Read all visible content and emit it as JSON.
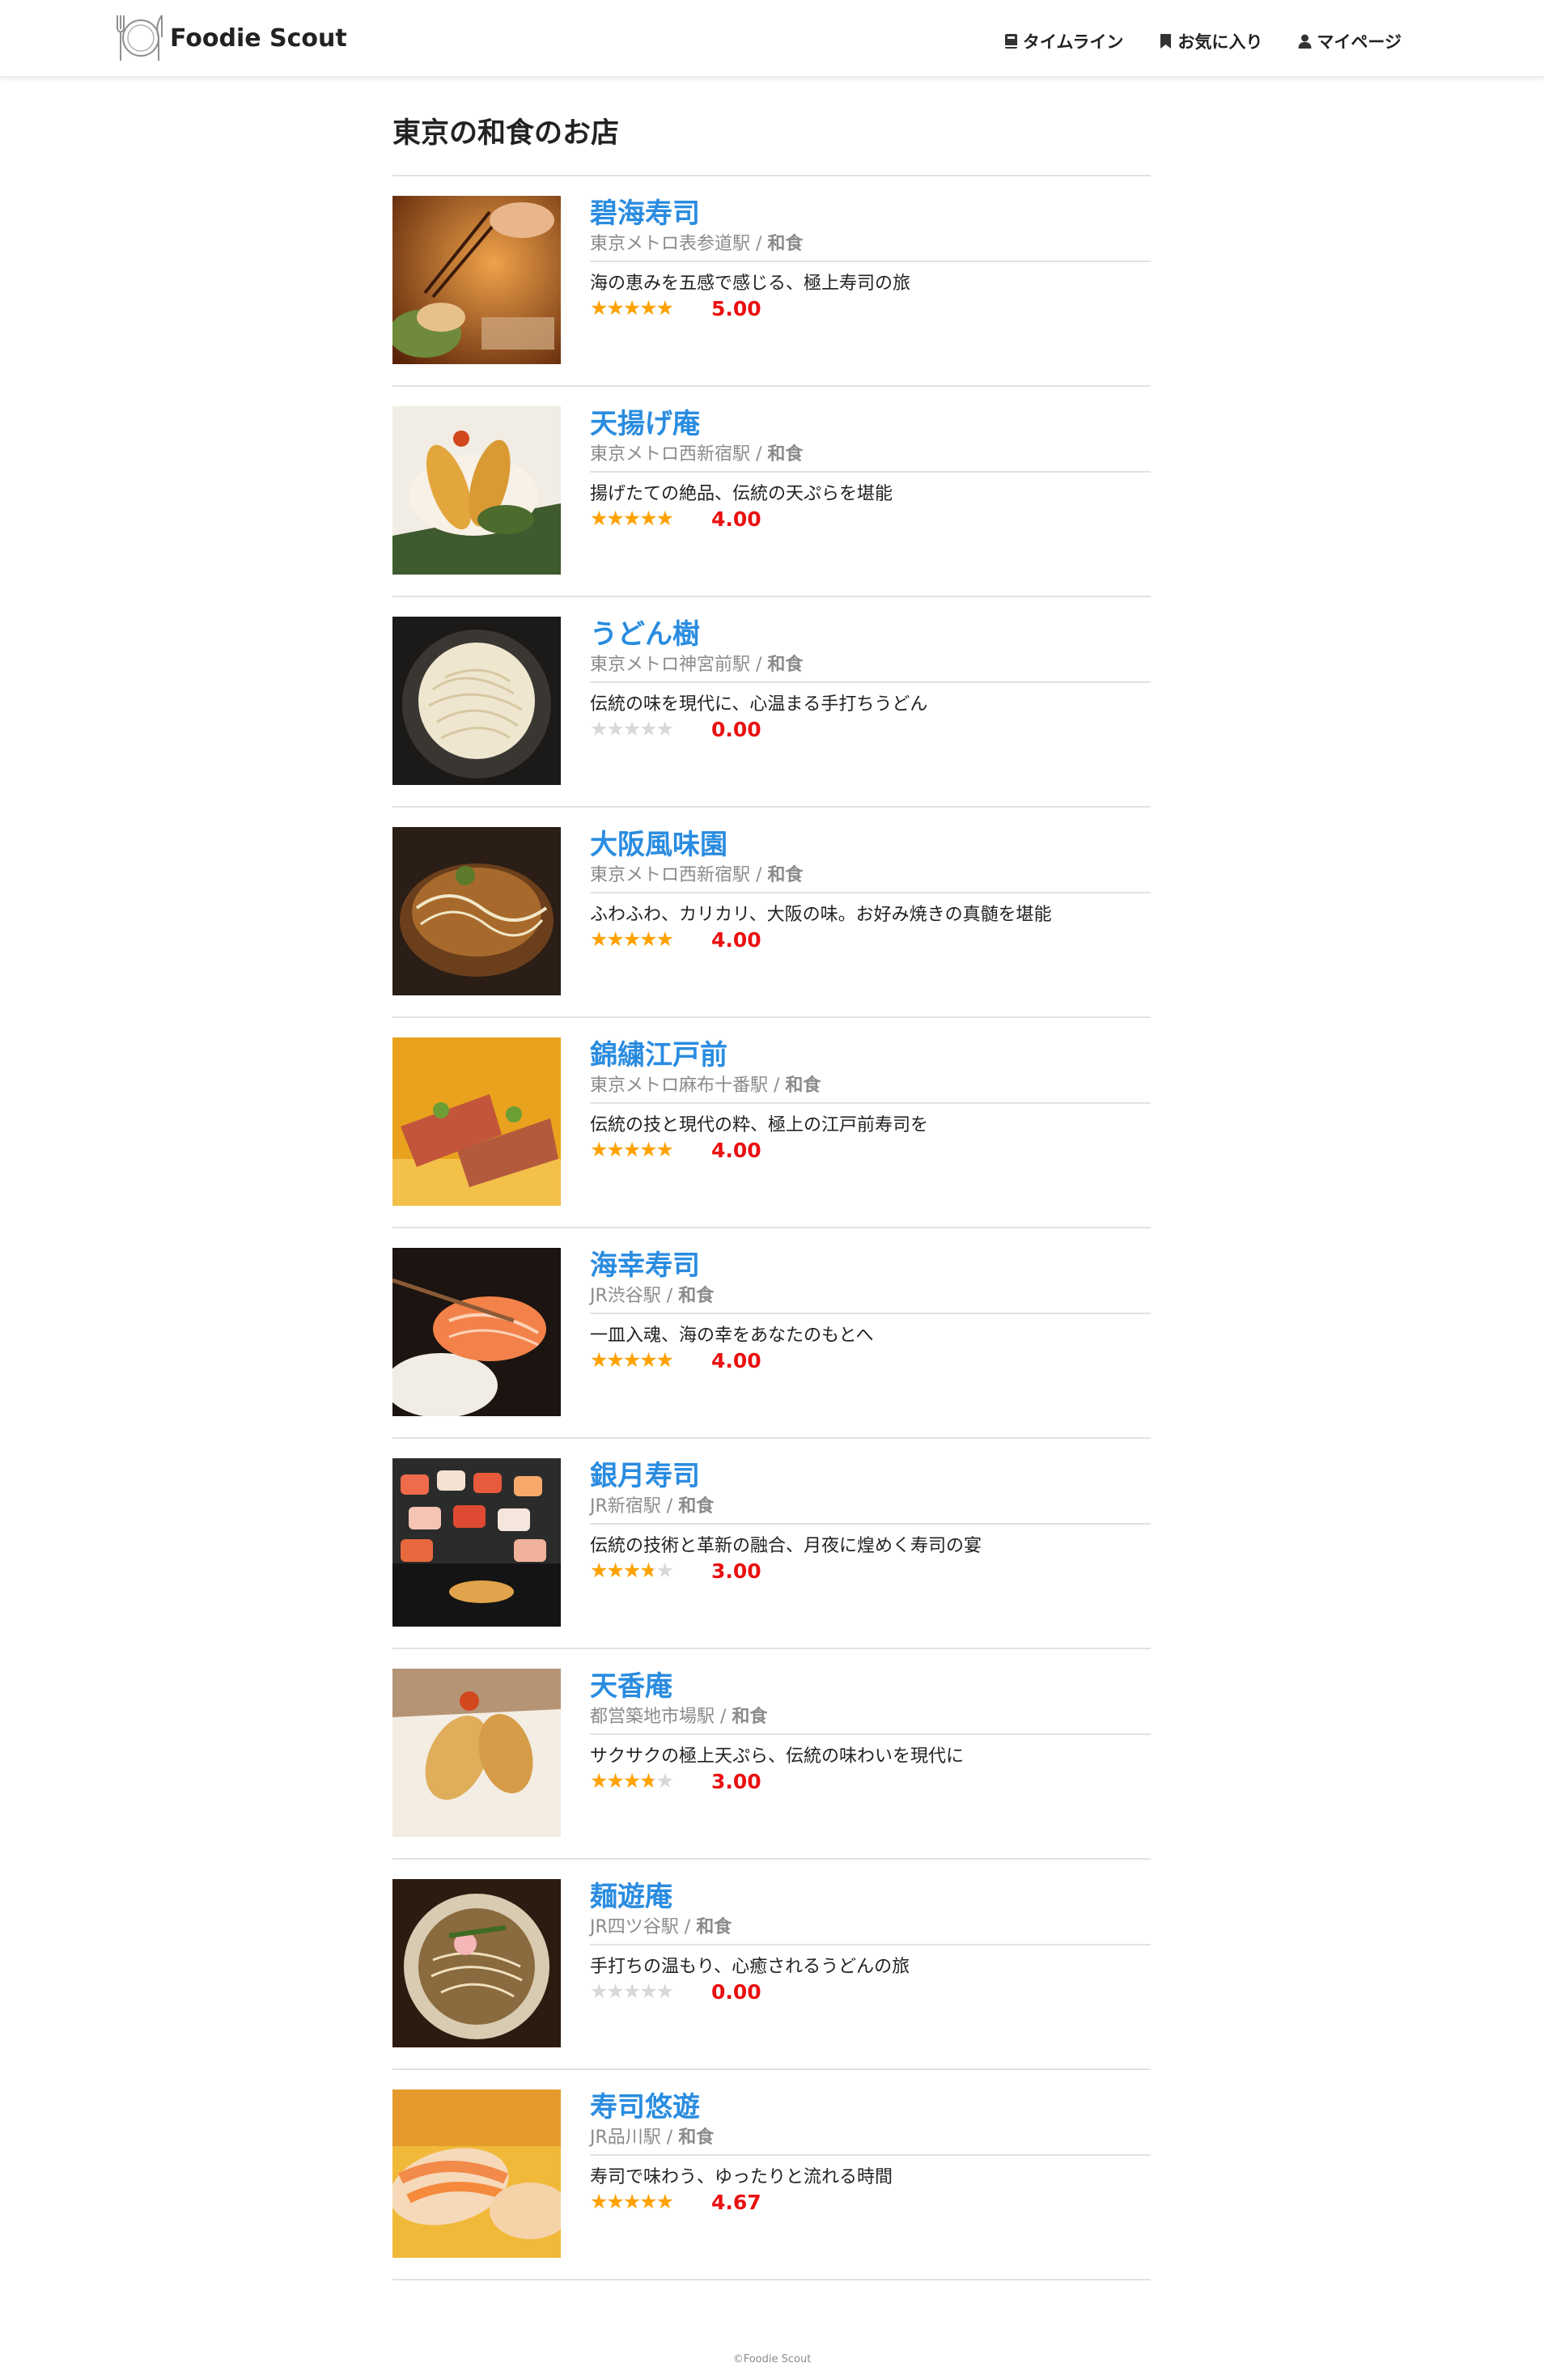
{
  "header": {
    "logo_text": "Foodie Scout",
    "nav": [
      {
        "label": "タイムライン",
        "icon": "book-icon"
      },
      {
        "label": "お気に入り",
        "icon": "bookmark-icon"
      },
      {
        "label": "マイページ",
        "icon": "user-icon"
      }
    ]
  },
  "page_title": "東京の和食のお店",
  "colors": {
    "name": "#2a8ce0",
    "star": "#ffa200",
    "star_empty": "#d8d8d8",
    "score": "#ea1010"
  },
  "restaurants": [
    {
      "name": "碧海寿司",
      "station": "東京メトロ表参道駅",
      "sep": " / ",
      "category": "和食",
      "description": "海の恵みを五感で感じる、極上寿司の旅",
      "rating": 5.0,
      "score": "5.00",
      "photo": "sushi"
    },
    {
      "name": "天揚げ庵",
      "station": "東京メトロ西新宿駅",
      "sep": " / ",
      "category": "和食",
      "description": "揚げたての絶品、伝統の天ぷらを堪能",
      "rating": 4.0,
      "score": "4.00",
      "photo": "tempura"
    },
    {
      "name": "うどん樹",
      "station": "東京メトロ神宮前駅",
      "sep": " / ",
      "category": "和食",
      "description": "伝統の味を現代に、心温まる手打ちうどん",
      "rating": 0.0,
      "score": "0.00",
      "photo": "udon"
    },
    {
      "name": "大阪風味園",
      "station": "東京メトロ西新宿駅",
      "sep": " / ",
      "category": "和食",
      "description": "ふわふわ、カリカリ、大阪の味。お好み焼きの真髄を堪能",
      "rating": 4.0,
      "score": "4.00",
      "photo": "okonomiyaki"
    },
    {
      "name": "錦繍江戸前",
      "station": "東京メトロ麻布十番駅",
      "sep": " / ",
      "category": "和食",
      "description": "伝統の技と現代の粋、極上の江戸前寿司を",
      "rating": 4.0,
      "score": "4.00",
      "photo": "nigiri"
    },
    {
      "name": "海幸寿司",
      "station": "JR渋谷駅",
      "sep": " / ",
      "category": "和食",
      "description": "一皿入魂、海の幸をあなたのもとへ",
      "rating": 4.0,
      "score": "4.00",
      "photo": "salmon"
    },
    {
      "name": "銀月寿司",
      "station": "JR新宿駅",
      "sep": " / ",
      "category": "和食",
      "description": "伝統の技術と革新の融合、月夜に煌めく寿司の宴",
      "rating": 3.0,
      "score": "3.00",
      "photo": "platter"
    },
    {
      "name": "天香庵",
      "station": "都営築地市場駅",
      "sep": " / ",
      "category": "和食",
      "description": "サクサクの極上天ぷら、伝統の味わいを現代に",
      "rating": 3.0,
      "score": "3.00",
      "photo": "tempura2"
    },
    {
      "name": "麺遊庵",
      "station": "JR四ツ谷駅",
      "sep": " / ",
      "category": "和食",
      "description": "手打ちの温もり、心癒されるうどんの旅",
      "rating": 0.0,
      "score": "0.00",
      "photo": "soba"
    },
    {
      "name": "寿司悠遊",
      "station": "JR品川駅",
      "sep": " / ",
      "category": "和食",
      "description": "寿司で味わう、ゆったりと流れる時間",
      "rating": 4.67,
      "score": "4.67",
      "photo": "shrimp"
    }
  ],
  "footer": "©Foodie Scout"
}
